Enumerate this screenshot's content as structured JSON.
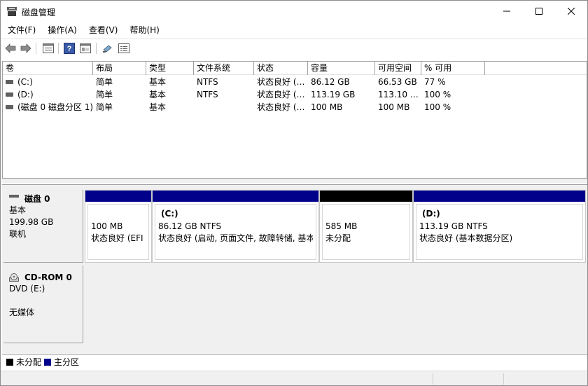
{
  "window": {
    "title": "磁盘管理"
  },
  "menu": [
    "文件(F)",
    "操作(A)",
    "查看(V)",
    "帮助(H)"
  ],
  "toolbar": {
    "icons": [
      "back-arrow-icon",
      "forward-arrow-icon",
      "properties-icon",
      "help-icon",
      "console-tree-icon",
      "settings-icon",
      "view-icon"
    ]
  },
  "volumes": {
    "columns": [
      "卷",
      "布局",
      "类型",
      "文件系统",
      "状态",
      "容量",
      "可用空间",
      "% 可用"
    ],
    "rows": [
      {
        "volume": "(C:)",
        "layout": "简单",
        "type": "基本",
        "fs": "NTFS",
        "status": "状态良好 (…",
        "capacity": "86.12 GB",
        "free": "66.53 GB",
        "pct": "77 %"
      },
      {
        "volume": "(D:)",
        "layout": "简单",
        "type": "基本",
        "fs": "NTFS",
        "status": "状态良好 (…",
        "capacity": "113.19 GB",
        "free": "113.10 …",
        "pct": "100 %"
      },
      {
        "volume": "(磁盘 0 磁盘分区 1)",
        "layout": "简单",
        "type": "基本",
        "fs": "",
        "status": "状态良好 (…",
        "capacity": "100 MB",
        "free": "100 MB",
        "pct": "100 %"
      }
    ]
  },
  "disks": {
    "disk0": {
      "title": "磁盘 0",
      "type": "基本",
      "size": "199.98 GB",
      "state": "联机",
      "partitions": [
        {
          "name": "",
          "size": "100 MB",
          "status": "状态良好 (EFI 系",
          "bar_color": "#00008b"
        },
        {
          "name": "(C:)",
          "size": "86.12 GB NTFS",
          "status": "状态良好 (启动, 页面文件, 故障转储, 基本数",
          "bar_color": "#00008b"
        },
        {
          "name": "",
          "size": "585 MB",
          "status": "未分配",
          "bar_color": "#000000"
        },
        {
          "name": "(D:)",
          "size": "113.19 GB NTFS",
          "status": "状态良好 (基本数据分区)",
          "bar_color": "#00008b"
        }
      ]
    },
    "cdrom0": {
      "title": "CD-ROM 0",
      "drive": "DVD (E:)",
      "media": "无媒体"
    }
  },
  "legend": [
    {
      "label": "未分配",
      "color": "#000000"
    },
    {
      "label": "主分区",
      "color": "#00008b"
    }
  ]
}
